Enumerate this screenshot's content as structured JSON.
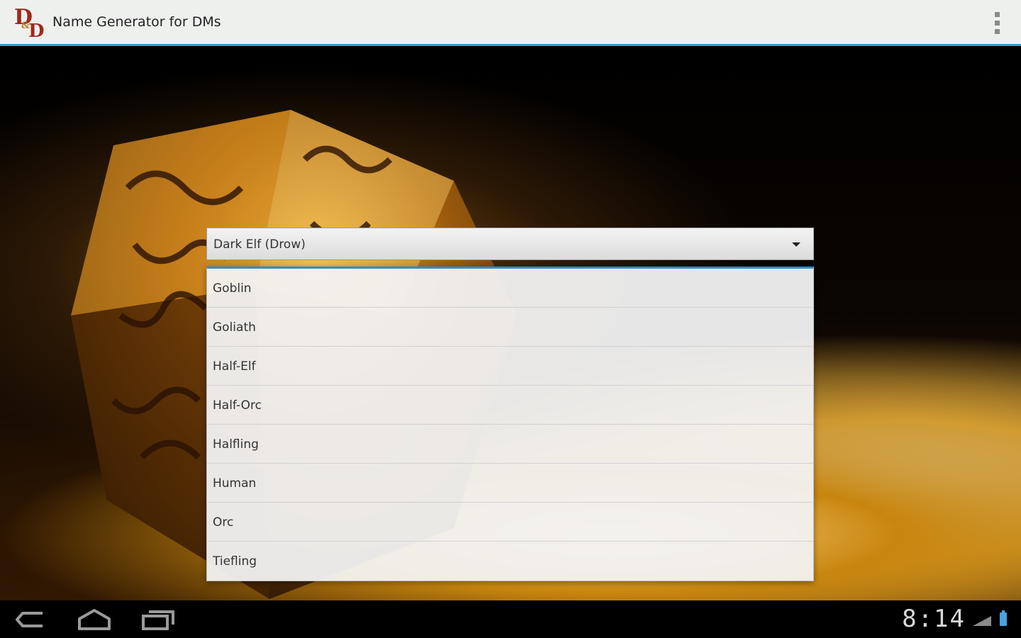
{
  "action_bar": {
    "logo_icon": "dnd-logo",
    "title": "Name Generator for DMs",
    "menu_icon": "overflow-menu-icon",
    "accent_color": "#2d9ed6"
  },
  "spinner": {
    "selected": "Dark Elf (Drow)"
  },
  "dropdown": {
    "items": [
      "Goblin",
      "Goliath",
      "Half-Elf",
      "Half-Orc",
      "Halfling",
      "Human",
      "Orc",
      "Tiefling"
    ]
  },
  "nav_bar": {
    "buttons": [
      "back-icon",
      "home-icon",
      "recent-apps-icon"
    ],
    "clock": "8:14"
  }
}
